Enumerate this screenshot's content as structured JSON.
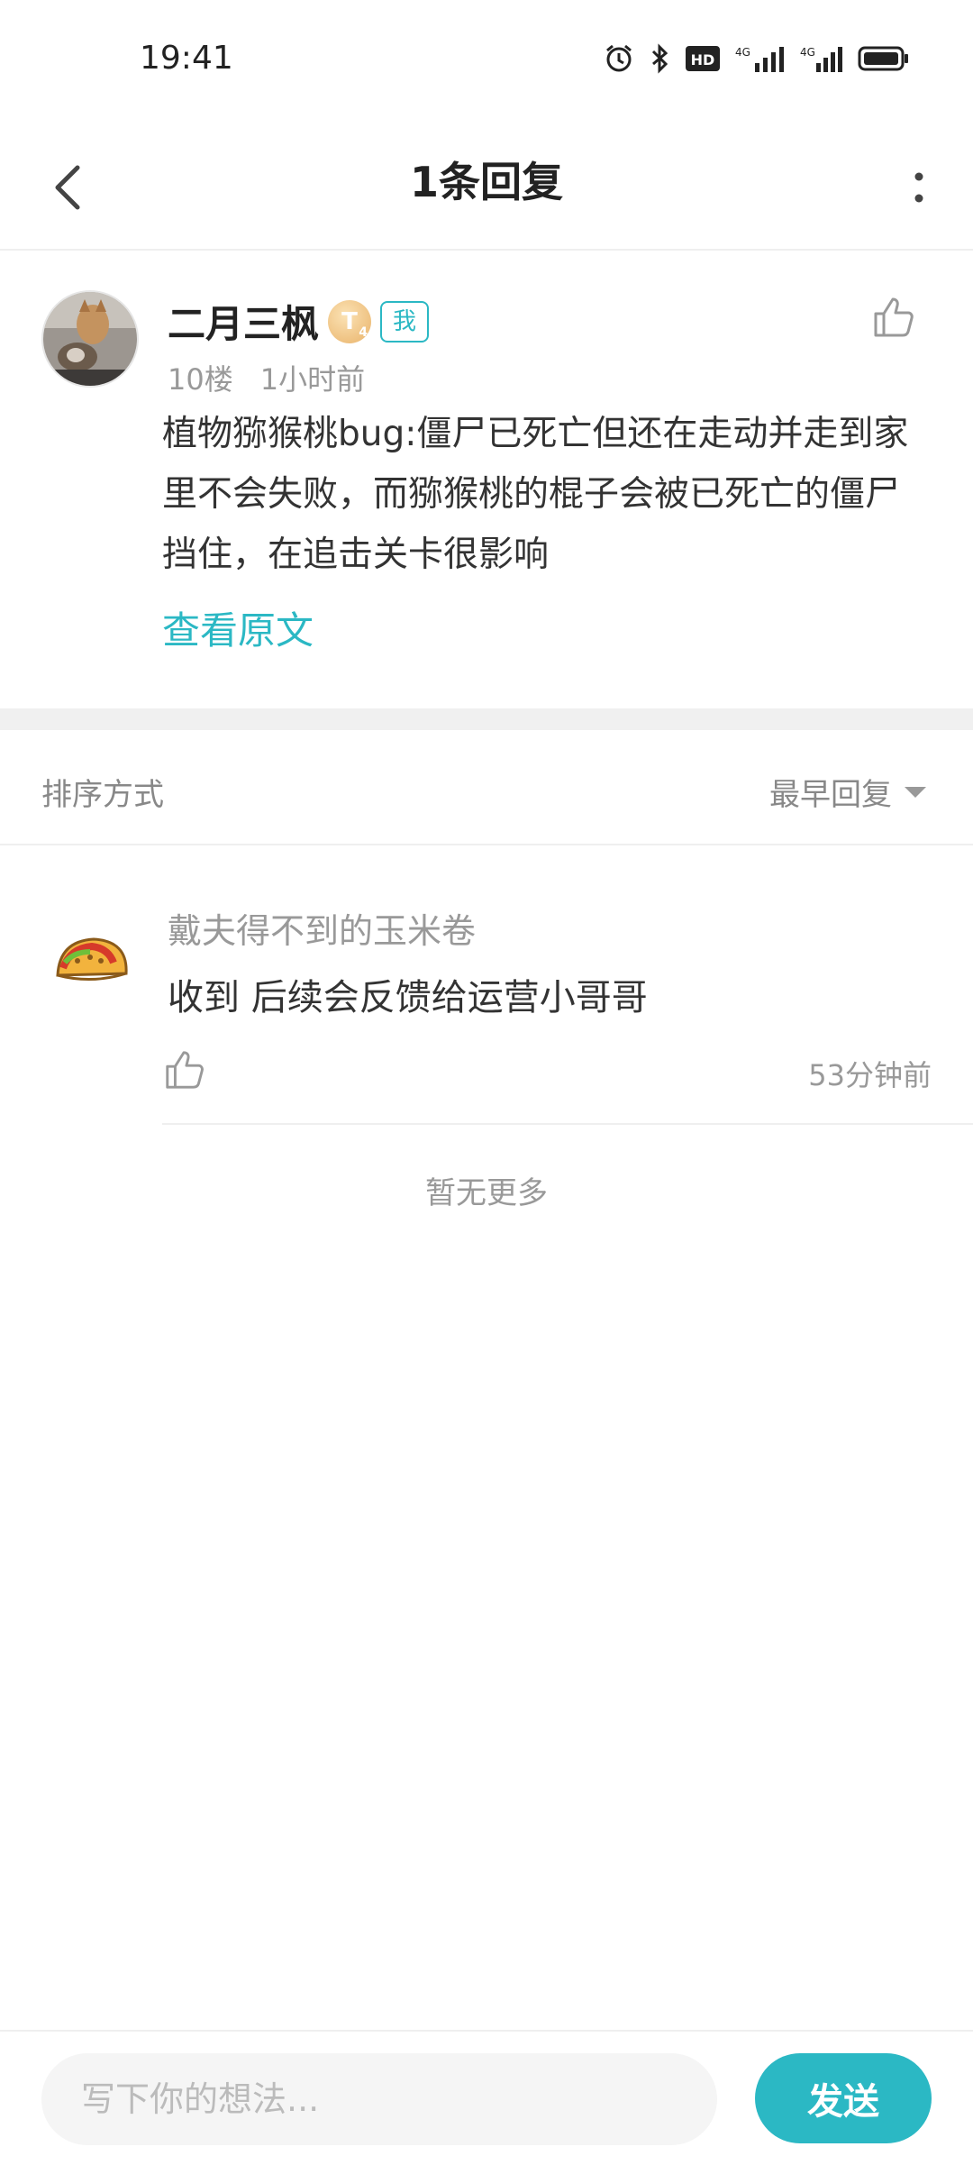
{
  "status_bar": {
    "time": "19:41",
    "icons": [
      "alarm-icon",
      "bluetooth-icon",
      "hd-icon",
      "signal-4g-icon",
      "signal-4g-icon",
      "battery-icon"
    ]
  },
  "nav": {
    "title": "1条回复",
    "back_icon": "chevron-left-icon",
    "more_icon": "more-vertical-icon"
  },
  "post": {
    "author": "二月三枫",
    "level_badge": "T",
    "me_badge": "我",
    "floor": "10楼",
    "time": "1小时前",
    "content": "植物猕猴桃bug:僵尸已死亡但还在走动并走到家里不会失败，而猕猴桃的棍子会被已死亡的僵尸挡住，在追击关卡很影响",
    "view_original": "查看原文"
  },
  "sort": {
    "label": "排序方式",
    "selected": "最早回复"
  },
  "replies": [
    {
      "author": "戴夫得不到的玉米卷",
      "text": "收到 后续会反馈给运营小哥哥",
      "time": "53分钟前"
    }
  ],
  "no_more": "暂无更多",
  "composer": {
    "placeholder": "写下你的想法...",
    "send_label": "发送"
  },
  "colors": {
    "accent": "#2bb8c4",
    "text_primary": "#333333",
    "text_secondary": "#999999",
    "divider": "#efefef"
  }
}
